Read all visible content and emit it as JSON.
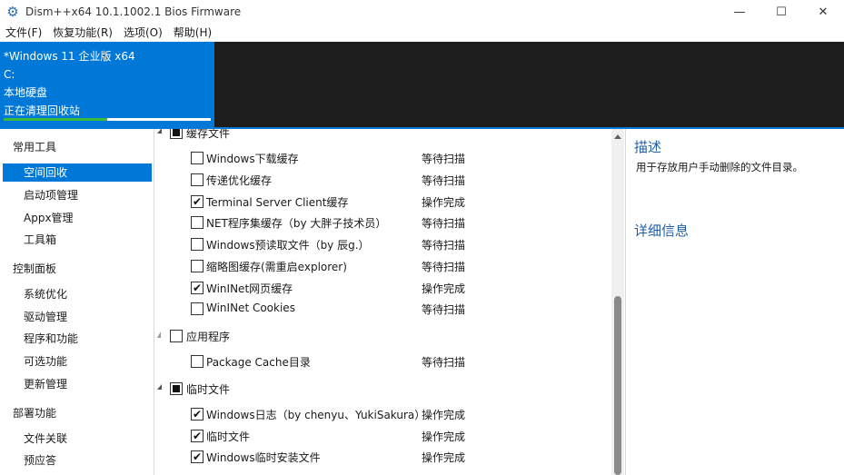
{
  "window": {
    "title": "Dism++x64 10.1.1002.1 Bios Firmware",
    "app_icon": "gear-icon",
    "minimize": "—",
    "maximize": "☐",
    "close": "✕"
  },
  "menu": [
    "文件(F)",
    "恢复功能(R)",
    "选项(O)",
    "帮助(H)"
  ],
  "image": {
    "name": "*Windows 11 企业版 x64",
    "drive": "C:",
    "disk": "本地硬盘",
    "status": "正在清理回收站",
    "progress_percent": 50
  },
  "sidebar": {
    "groups": [
      {
        "label": "常用工具",
        "items": [
          "空间回收",
          "启动项管理",
          "Appx管理",
          "工具箱"
        ]
      },
      {
        "label": "控制面板",
        "items": [
          "系统优化",
          "驱动管理",
          "程序和功能",
          "可选功能",
          "更新管理"
        ]
      },
      {
        "label": "部署功能",
        "items": [
          "文件关联",
          "预应答"
        ]
      }
    ],
    "active_item": "空间回收"
  },
  "list": {
    "rows": [
      {
        "type": "group",
        "label": "缓存文件",
        "state": "partial"
      },
      {
        "type": "item",
        "label": "Windows下载缓存",
        "checked": false,
        "status": "等待扫描"
      },
      {
        "type": "item",
        "label": "传递优化缓存",
        "checked": false,
        "status": "等待扫描"
      },
      {
        "type": "item",
        "label": "Terminal Server Client缓存",
        "checked": true,
        "status": "操作完成"
      },
      {
        "type": "item",
        "label": "NET程序集缓存（by 大胖子技术员）",
        "checked": false,
        "status": "等待扫描"
      },
      {
        "type": "item",
        "label": "Windows预读取文件（by 辰g.）",
        "checked": false,
        "status": "等待扫描"
      },
      {
        "type": "item",
        "label": "缩略图缓存(需重启explorer)",
        "checked": false,
        "status": "等待扫描"
      },
      {
        "type": "item",
        "label": "WinINet网页缓存",
        "checked": true,
        "status": "操作完成"
      },
      {
        "type": "item",
        "label": "WinINet Cookies",
        "checked": false,
        "status": "等待扫描"
      },
      {
        "type": "group",
        "label": "应用程序",
        "state": "unchecked"
      },
      {
        "type": "item",
        "label": "Package Cache目录",
        "checked": false,
        "status": "等待扫描"
      },
      {
        "type": "group",
        "label": "临时文件",
        "state": "partial"
      },
      {
        "type": "item",
        "label": "Windows日志（by chenyu、YukiSakura）",
        "checked": true,
        "status": "操作完成"
      },
      {
        "type": "item",
        "label": "临时文件",
        "checked": true,
        "status": "操作完成"
      },
      {
        "type": "item",
        "label": "Windows临时安装文件",
        "checked": true,
        "status": "操作完成"
      }
    ]
  },
  "details": {
    "desc_title": "描述",
    "desc_text": "用于存放用户手动删除的文件目录。",
    "info_title": "详细信息"
  },
  "colors": {
    "accent": "#0078d7",
    "header_bg": "#1e1e1e",
    "progress": "#3cba3c",
    "link_title": "#1f5fa8"
  }
}
